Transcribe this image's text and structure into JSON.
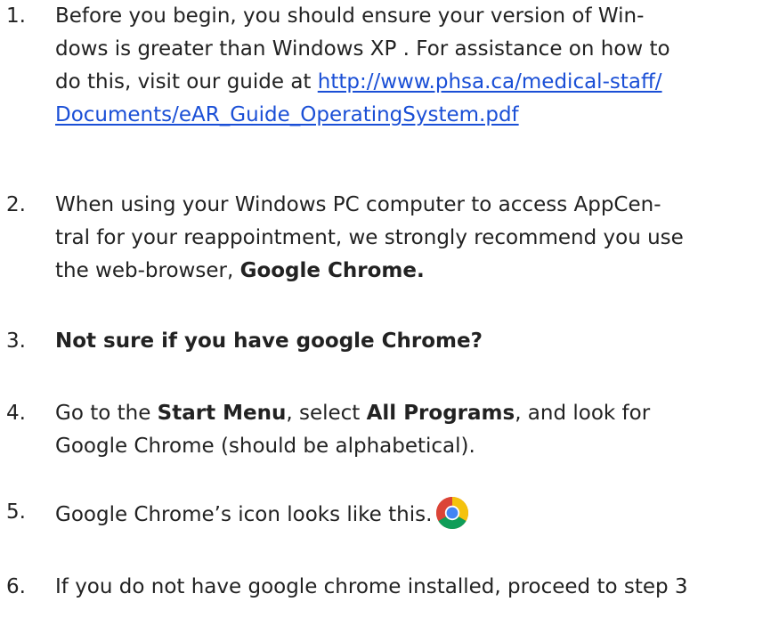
{
  "items": [
    {
      "number": "1.",
      "line1": "Before you begin, you should ensure your version of Win-",
      "line2": "dows is greater than Windows XP . For assistance on how to",
      "line3_pre": "do this, visit our guide at ",
      "link_part1": "http://www.phsa.ca/medical-staff/",
      "link_part2": "Documents/eAR_Guide_OperatingSystem.pdf"
    },
    {
      "number": "2.",
      "line1": "When using your Windows PC computer to access AppCen-",
      "line2": "tral for your reappointment, we strongly recommend you use",
      "line3_pre": "the web-browser, ",
      "line3_bold": "Google Chrome."
    },
    {
      "number": "3.",
      "bold": "Not sure if you have google Chrome?"
    },
    {
      "number": "4.",
      "pre": "Go to the ",
      "bold1": "Start Menu",
      "mid": ", select ",
      "bold2": "All Programs",
      "post": ", and look for",
      "line2": "Google Chrome (should be alphabetical)."
    },
    {
      "number": "5.",
      "text": "Google Chrome’s icon looks like this.",
      "icon": "chrome-logo-icon"
    },
    {
      "number": "6.",
      "text": "If you do not have google chrome installed, proceed to step 3"
    }
  ],
  "colors": {
    "text": "#222222",
    "link": "#1a4fd6",
    "chrome_red": "#db4437",
    "chrome_yellow": "#f4c20d",
    "chrome_green": "#0f9d58",
    "chrome_blue": "#4285f4"
  }
}
